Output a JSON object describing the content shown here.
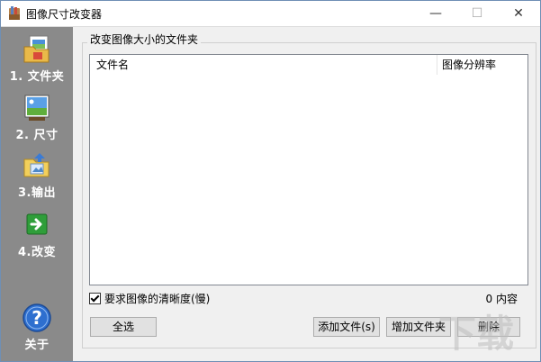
{
  "window": {
    "title": "图像尺寸改变器",
    "minimize_glyph": "—",
    "maximize_glyph": "☐",
    "close_glyph": "✕"
  },
  "sidebar": {
    "items": [
      {
        "label": "1. 文件夹",
        "icon": "folder-document-icon"
      },
      {
        "label": "2. 尺寸",
        "icon": "landscape-image-icon"
      },
      {
        "label": "3.输出",
        "icon": "output-folder-icon"
      },
      {
        "label": "4.改变",
        "icon": "green-arrow-icon"
      }
    ],
    "about_label": "关于",
    "about_icon": "help-question-icon"
  },
  "main": {
    "group_title": "改变图像大小的文件夹",
    "columns": [
      "文件名",
      "图像分辨率"
    ],
    "checkbox_label": "要求图像的清晰度(慢)",
    "checkbox_checked": true,
    "count_label": "0 内容",
    "buttons": {
      "select_all": "全选",
      "add_file": "添加文件(s)",
      "add_folder": "增加文件夹",
      "delete": "删除"
    }
  },
  "watermark": "下载"
}
